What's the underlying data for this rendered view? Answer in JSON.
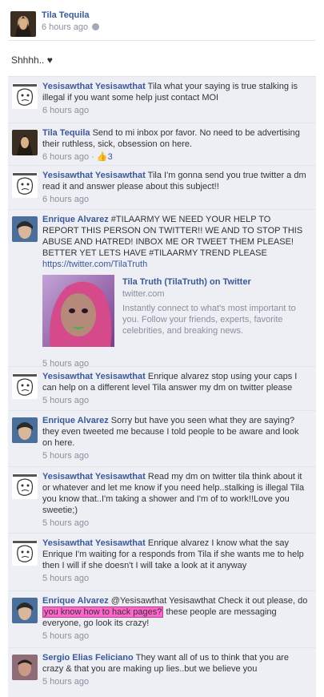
{
  "post": {
    "author": "Tila Tequila",
    "time": "6 hours ago",
    "text": "Shhhh.. ♥"
  },
  "comments": [
    {
      "author": "Yesisawthat Yesisawthat",
      "text": "Tila what your saying is true stalking is illegal if you want some help just contact MOI",
      "time": "6 hours ago"
    },
    {
      "author": "Tila Tequila",
      "text": "Send to mi inbox por favor. No need to be advertising their ruthless, sick, obsession on here.",
      "time": "6 hours ago",
      "separator": "·",
      "like_icon": "thumbs-up-icon",
      "like_count": "3"
    },
    {
      "author": "Yesisawthat Yesisawthat",
      "text": "Tila I'm gonna send you true twitter a dm read it and answer please about this subject!!",
      "time": "6 hours ago"
    },
    {
      "author": "Enrique Alvarez",
      "text": "#TILAARMY WE NEED YOUR HELP TO REPORT THIS PERSON ON TWITTER!! WE AND TO STOP THIS ABUSE AND HATRED! INBOX ME OR TWEET THEM PLEASE! BETTER YET LETS HAVE #TILAARMY TREND PLEASE",
      "link": "https://twitter.com/TilaTruth",
      "share": {
        "title": "Tila Truth (TilaTruth) on Twitter",
        "domain": "twitter.com",
        "description": "Instantly connect to what's most important to you. Follow your friends, experts, favorite celebrities, and breaking news."
      },
      "time": "5 hours ago"
    },
    {
      "author": "Yesisawthat Yesisawthat",
      "text": "Enrique alvarez stop using your caps I can help on a different level Tila answer my dm on twitter please",
      "time": "5 hours ago"
    },
    {
      "author": "Enrique Alvarez",
      "text": "Sorry but have you seen what they are saying? they even tweeted me because I told people to be aware and look on here.",
      "time": "5 hours ago"
    },
    {
      "author": "Yesisawthat Yesisawthat",
      "text": "Read my dm on twitter tila think about it or whatever and let me know if you need help..stalking is illegal Tila you know that..I'm taking a shower and I'm of to work!!Love you sweetie;)",
      "time": "5 hours ago"
    },
    {
      "author": "Yesisawthat Yesisawthat",
      "text": "Enrique alvarez I know what the say Enrique I'm waiting for a responds from Tila if she wants me to help then I will if she doesn't I will take a look at it anyway",
      "time": "5 hours ago"
    },
    {
      "author": "Enrique Alvarez",
      "text_before": "@Yesisawthat Yesisawthat Check it out please, do",
      "highlight": "you know how to hack pages?",
      "text_after": "these people are messaging everyone, go look its crazy!",
      "time": "5 hours ago"
    },
    {
      "author": "Sergio Elias Feliciano",
      "text": "They want all of us to think that you are crazy & that you are making up lies..but we believe you",
      "time": "5 hours ago"
    }
  ]
}
